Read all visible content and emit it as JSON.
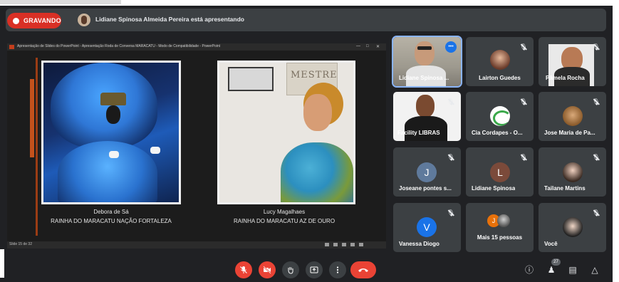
{
  "meet": {
    "recording_label": "GRAVANDO",
    "presenting_text": "Lidiane Spinosa Almeida Pereira está apresentando"
  },
  "presentation": {
    "window_title": "Apresentação de Slides do PowerPoint - Apresentação Roda de Conversa MARACATU - Modo de Compatibilidade - PowerPoint",
    "status_text": "Slide 15 de 32",
    "sign_text": "MESTRE",
    "captions": [
      {
        "name": "Debora de Sá",
        "title": "RAINHA DO MARACATU NAÇÃO FORTALEZA"
      },
      {
        "name": "Lucy Magalhaes",
        "title": "RAINHA DO MARACATU AZ DE OURO"
      }
    ]
  },
  "participants": [
    {
      "name": "Lidiane Spinosa ..."
    },
    {
      "name": "Lairton Guedes"
    },
    {
      "name": "Pâmela Rocha"
    },
    {
      "name": "Facility LIBRAS"
    },
    {
      "name": "Cia Cordapes - O..."
    },
    {
      "name": "Jose Maria de Pa..."
    },
    {
      "name": "Joseane pontes s...",
      "initial": "J"
    },
    {
      "name": "Lidiane Spinosa",
      "initial": "L"
    },
    {
      "name": "Tailane Martins"
    },
    {
      "name": "Vanessa Diogo",
      "initial": "V"
    },
    {
      "name": "Mais 15 pessoas",
      "initial": "J"
    },
    {
      "name": "Você"
    }
  ],
  "people_count": "27",
  "colors": {
    "recording": "#d93025",
    "end_call": "#ea4335",
    "speaking": "#1a73e8",
    "avatar_j": "#5f7a9c",
    "avatar_l": "#7b4a3a",
    "avatar_v": "#1a73e8"
  },
  "icons": {
    "toolbar": [
      "mic-off-icon",
      "camera-off-icon",
      "raise-hand-icon",
      "present-icon",
      "more-options-icon",
      "end-call-icon"
    ],
    "right": [
      "info-icon",
      "people-icon",
      "chat-icon",
      "activities-icon"
    ]
  }
}
